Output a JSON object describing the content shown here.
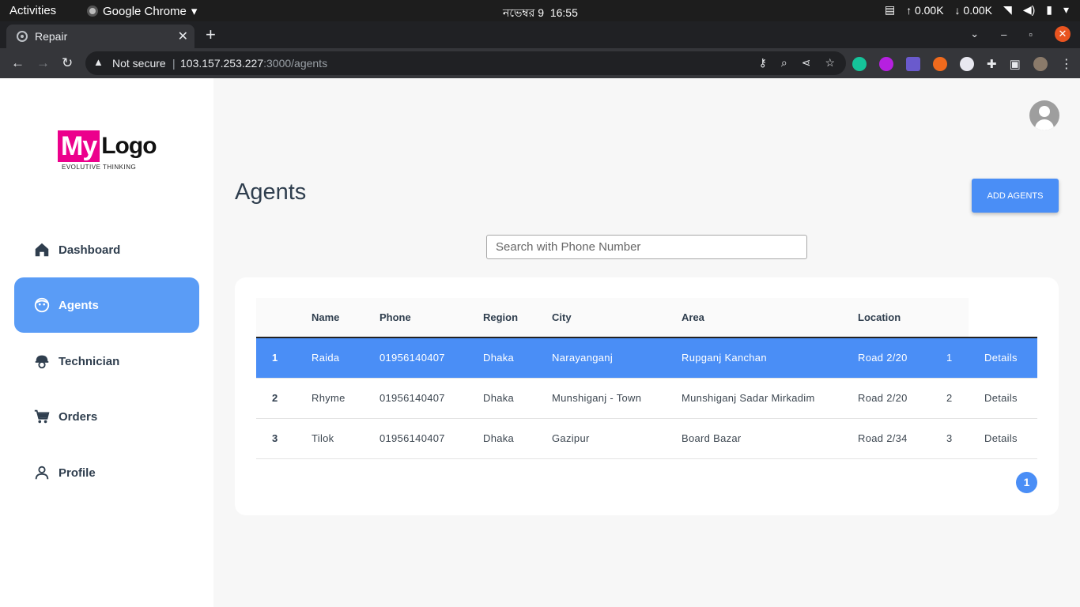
{
  "system_bar": {
    "activities": "Activities",
    "app_name": "Google Chrome",
    "clock_date": "নভেম্বর 9",
    "clock_time": "16:55",
    "net_up": "↑ 0.00K",
    "net_down": "↓ 0.00K"
  },
  "browser": {
    "tab_title": "Repair",
    "security_label": "Not secure",
    "url_host": "103.157.253.227",
    "url_path": ":3000/agents"
  },
  "sidebar": {
    "logo_part1": "My",
    "logo_part2": "Logo",
    "logo_tagline": "EVOLUTIVE THINKING",
    "items": [
      {
        "label": "Dashboard",
        "icon": "home-icon"
      },
      {
        "label": "Agents",
        "icon": "agent-face-icon",
        "active": true
      },
      {
        "label": "Technician",
        "icon": "technician-helmet-icon"
      },
      {
        "label": "Orders",
        "icon": "cart-icon"
      },
      {
        "label": "Profile",
        "icon": "person-icon"
      }
    ]
  },
  "main": {
    "title": "Agents",
    "add_button": "ADD AGENTS",
    "search_placeholder": "Search with Phone Number",
    "table": {
      "columns": [
        "",
        "Name",
        "Phone",
        "Region",
        "City",
        "Area",
        "Location",
        "",
        ""
      ],
      "rows": [
        {
          "idx": "1",
          "name": "Raida",
          "phone": "01956140407",
          "region": "Dhaka",
          "city": "Narayanganj",
          "area": "Rupganj Kanchan",
          "location": "Road 2/20",
          "id": "1",
          "action": "Details",
          "selected": true
        },
        {
          "idx": "2",
          "name": "Rhyme",
          "phone": "01956140407",
          "region": "Dhaka",
          "city": "Munshiganj - Town",
          "area": "Munshiganj Sadar Mirkadim",
          "location": "Road 2/20",
          "id": "2",
          "action": "Details"
        },
        {
          "idx": "3",
          "name": "Tilok",
          "phone": "01956140407",
          "region": "Dhaka",
          "city": "Gazipur",
          "area": "Board Bazar",
          "location": "Road 2/34",
          "id": "3",
          "action": "Details"
        }
      ]
    },
    "page": "1"
  },
  "colors": {
    "accent": "#4a8ef6",
    "nav_active": "#5a9cf6",
    "logo_pink": "#ec008c",
    "text_dark": "#2f3e4e"
  }
}
